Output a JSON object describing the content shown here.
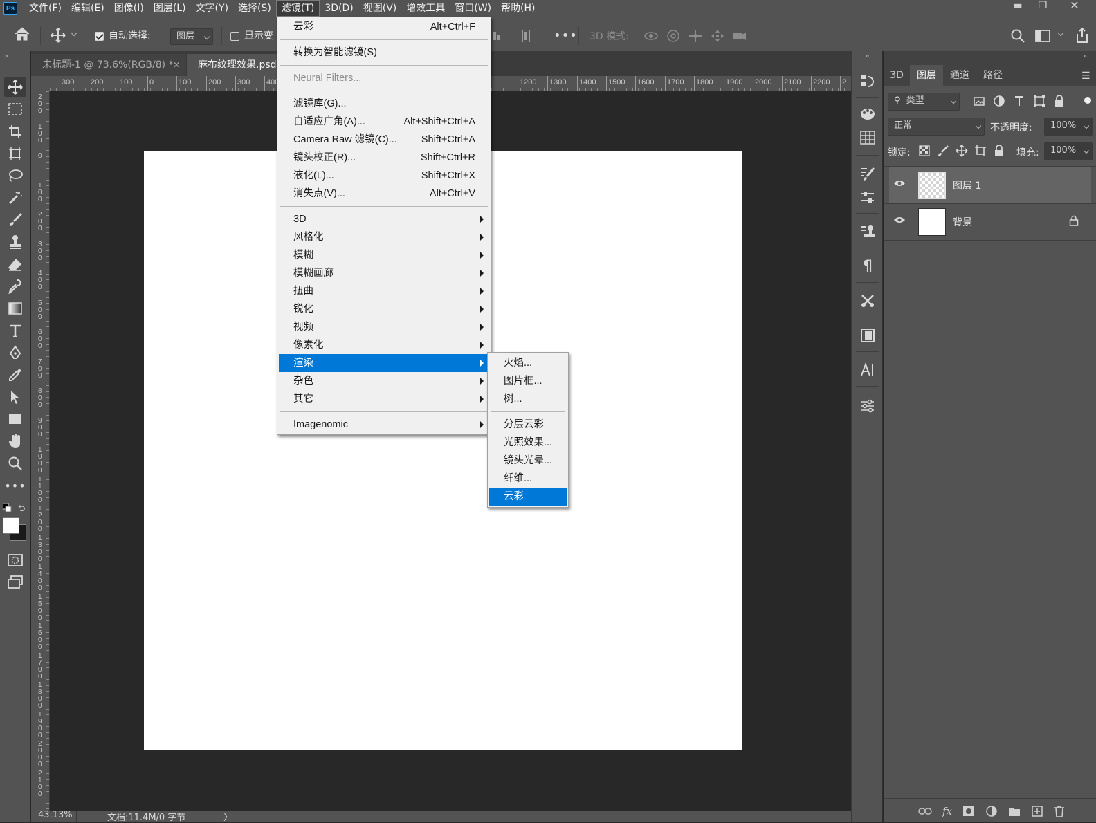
{
  "app": {
    "logo": "Ps"
  },
  "menubar": {
    "items": [
      "文件(F)",
      "编辑(E)",
      "图像(I)",
      "图层(L)",
      "文字(Y)",
      "选择(S)",
      "滤镜(T)",
      "3D(D)",
      "视图(V)",
      "增效工具",
      "窗口(W)",
      "帮助(H)"
    ],
    "active_index": 6
  },
  "options": {
    "auto_select_label": "自动选择:",
    "auto_select_checked": true,
    "auto_select_target": "图层",
    "show_transform_label": "显示变",
    "mode_3d_label": "3D 模式:"
  },
  "tabs": [
    {
      "label": "未标题-1 @ 73.6%(RGB/8) *",
      "close": "×",
      "active": false
    },
    {
      "label": "麻布纹理效果.psd",
      "active": true
    }
  ],
  "ruler": {
    "h_labels": [
      "300",
      "200",
      "100",
      "0",
      "100",
      "200",
      "300",
      "400",
      "1200",
      "1300",
      "1400",
      "1500",
      "1600",
      "1700",
      "1800",
      "1900",
      "2000",
      "2100",
      "2200",
      "2"
    ],
    "v_labels": [
      "200",
      "100",
      "0",
      "100",
      "200",
      "300",
      "400",
      "500",
      "600",
      "700",
      "800",
      "900",
      "1000",
      "1100",
      "1200",
      "1300",
      "1400",
      "1500",
      "1600",
      "1700",
      "1800",
      "1900",
      "2000",
      "2100"
    ]
  },
  "status": {
    "zoom": "43.13%",
    "doc_info": "文档:11.4M/0 字节",
    "arrow": "〉"
  },
  "filter_menu": {
    "items": [
      {
        "label": "云彩",
        "shortcut": "Alt+Ctrl+F"
      },
      {
        "sep": true
      },
      {
        "label": "转换为智能滤镜(S)"
      },
      {
        "sep": true
      },
      {
        "label": "Neural Filters...",
        "disabled": true
      },
      {
        "sep": true
      },
      {
        "label": "滤镜库(G)..."
      },
      {
        "label": "自适应广角(A)...",
        "shortcut": "Alt+Shift+Ctrl+A"
      },
      {
        "label": "Camera Raw 滤镜(C)...",
        "shortcut": "Shift+Ctrl+A"
      },
      {
        "label": "镜头校正(R)...",
        "shortcut": "Shift+Ctrl+R"
      },
      {
        "label": "液化(L)...",
        "shortcut": "Shift+Ctrl+X"
      },
      {
        "label": "消失点(V)...",
        "shortcut": "Alt+Ctrl+V"
      },
      {
        "sep": true
      },
      {
        "label": "3D",
        "submenu": true
      },
      {
        "label": "风格化",
        "submenu": true
      },
      {
        "label": "模糊",
        "submenu": true
      },
      {
        "label": "模糊画廊",
        "submenu": true
      },
      {
        "label": "扭曲",
        "submenu": true
      },
      {
        "label": "锐化",
        "submenu": true
      },
      {
        "label": "视频",
        "submenu": true
      },
      {
        "label": "像素化",
        "submenu": true
      },
      {
        "label": "渲染",
        "submenu": true,
        "highlight": true
      },
      {
        "label": "杂色",
        "submenu": true
      },
      {
        "label": "其它",
        "submenu": true
      },
      {
        "sep": true
      },
      {
        "label": "Imagenomic",
        "submenu": true
      }
    ]
  },
  "render_submenu": {
    "items": [
      {
        "label": "火焰..."
      },
      {
        "label": "图片框..."
      },
      {
        "label": "树..."
      },
      {
        "sep": true
      },
      {
        "label": "分层云彩"
      },
      {
        "label": "光照效果..."
      },
      {
        "label": "镜头光晕..."
      },
      {
        "label": "纤维..."
      },
      {
        "label": "云彩",
        "highlight": true
      }
    ]
  },
  "layers_panel": {
    "tabs": [
      "3D",
      "图层",
      "通道",
      "路径"
    ],
    "active_tab_index": 1,
    "filter_label": "类型",
    "blend_mode": "正常",
    "opacity_label": "不透明度:",
    "opacity_value": "100%",
    "lock_label": "锁定:",
    "fill_label": "填充:",
    "fill_value": "100%",
    "layers": [
      {
        "name": "图层 1",
        "selected": true,
        "transparent": true,
        "locked": false
      },
      {
        "name": "背景",
        "selected": false,
        "transparent": false,
        "locked": true
      }
    ]
  }
}
